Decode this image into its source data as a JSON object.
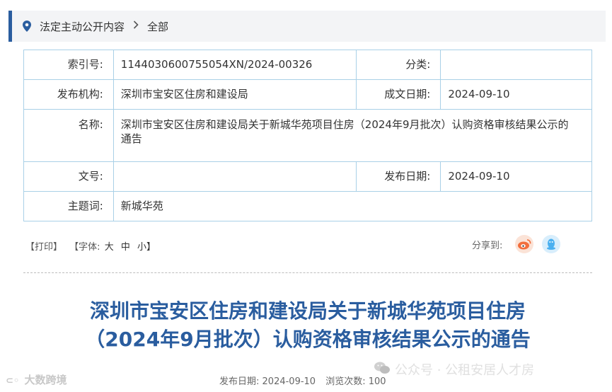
{
  "breadcrumb": {
    "icon": "location-pin-icon",
    "section": "法定主动公开内容",
    "separator_icon": "chevron-right-icon",
    "current": "全部"
  },
  "meta": {
    "index_label": "索引号:",
    "index_value": "1144030600755054XN/2024-00326",
    "category_label": "分类:",
    "category_value": "",
    "publisher_label": "发布机构:",
    "publisher_value": "深圳市宝安区住房和建设局",
    "created_label": "成文日期:",
    "created_value": "2024-09-10",
    "name_label": "名称:",
    "name_value": "深圳市宝安区住房和建设局关于新城华苑项目住房（2024年9月批次）认购资格审核结果公示的通告",
    "docno_label": "文号:",
    "docno_value": "",
    "publish_label": "发布日期:",
    "publish_value": "2024-09-10",
    "subject_label": "主题词:",
    "subject_value": "新城华苑"
  },
  "tools": {
    "print": "【打印】",
    "font_prefix": "【字体:",
    "font_large": "大",
    "font_medium": "中",
    "font_small": "小】",
    "share_label": "分享到:",
    "share_icons": [
      "weibo-icon",
      "qq-icon"
    ]
  },
  "article": {
    "title_line1": "深圳市宝安区住房和建设局关于新城华苑项目住房",
    "title_line2": "（2024年9月批次）认购资格审核结果公示的通告",
    "publish_date_label": "发布日期:",
    "publish_date": "2024-09-10",
    "views_label": "浏览次数:",
    "views": "100"
  },
  "watermarks": {
    "left": "大数跨境",
    "right": "公众号 · 公租安居人才房"
  },
  "colors": {
    "accent": "#2a5d9f",
    "table_border": "#a9d0e7",
    "weibo": "#f26e3d",
    "qq": "#4ab0f0"
  }
}
